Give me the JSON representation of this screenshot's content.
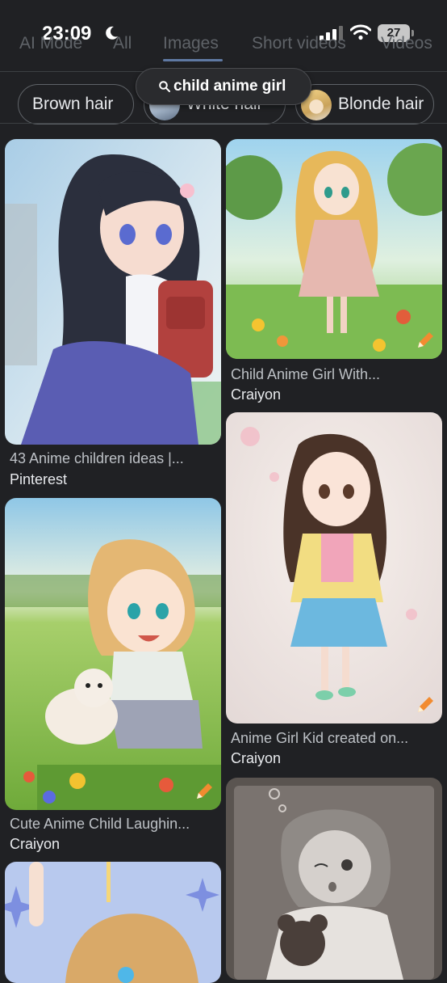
{
  "status": {
    "time": "23:09",
    "battery": "27"
  },
  "tabs": [
    {
      "label": "AI Mode"
    },
    {
      "label": "All"
    },
    {
      "label": "Images"
    },
    {
      "label": "Short videos"
    },
    {
      "label": "Videos"
    }
  ],
  "search": {
    "query": "child anime girl"
  },
  "chips": [
    {
      "label": "Brown hair"
    },
    {
      "label": "White hair"
    },
    {
      "label": "Blonde hair"
    }
  ],
  "results": [
    {
      "caption": "43 Anime children ideas |...",
      "source": "Pinterest"
    },
    {
      "caption": "Child Anime Girl With...",
      "source": "Craiyon"
    },
    {
      "caption": "Anime Girl Kid created on...",
      "source": "Craiyon"
    },
    {
      "caption": "Cute Anime Child Laughin...",
      "source": "Craiyon"
    }
  ],
  "colors": {
    "background": "#202124",
    "accent": "#8ab4f8",
    "craiyon_badge": "#f28b30"
  }
}
